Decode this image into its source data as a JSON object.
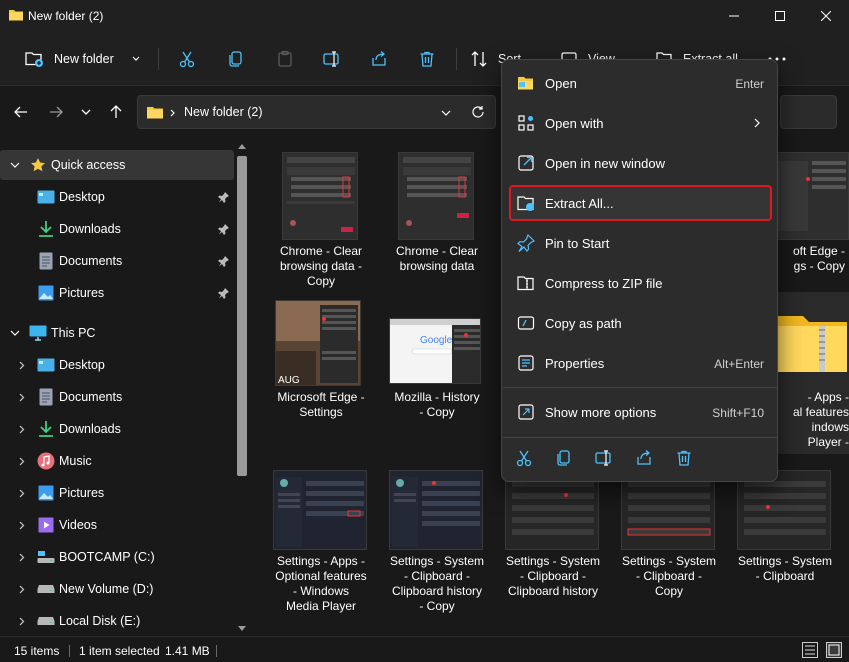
{
  "window": {
    "title": "New folder (2)"
  },
  "toolbar": {
    "new_folder_label": "New folder",
    "sort_label": "Sort",
    "view_label": "View",
    "extract_all_label": "Extract all"
  },
  "address": {
    "breadcrumb": "New folder (2)"
  },
  "nav": {
    "quick_access_label": "Quick access",
    "quick_items": [
      "Desktop",
      "Downloads",
      "Documents",
      "Pictures"
    ],
    "this_pc_label": "This PC",
    "pc_items": [
      "Desktop",
      "Documents",
      "Downloads",
      "Music",
      "Pictures",
      "Videos",
      "BOOTCAMP (C:)",
      "New Volume (D:)",
      "Local Disk (E:)"
    ]
  },
  "files": [
    {
      "caption": [
        "Chrome - Clear",
        "browsing data -",
        "Copy"
      ]
    },
    {
      "caption": [
        "Chrome - Clear",
        "browsing data"
      ]
    },
    {
      "caption": [
        "oft Edge -",
        "gs - Copy"
      ]
    },
    {
      "caption": [
        "Microsoft Edge -",
        "Settings"
      ]
    },
    {
      "caption": [
        "Mozilla - History",
        "- Copy"
      ]
    },
    {
      "caption": [
        "- Apps -",
        "al features",
        "indows",
        "Player -"
      ]
    },
    {
      "caption": [
        "Settings - Apps -",
        "Optional features",
        "- Windows",
        "Media Player"
      ]
    },
    {
      "caption": [
        "Settings - System",
        "- Clipboard -",
        "Clipboard history",
        "- Copy"
      ]
    },
    {
      "caption": [
        "Settings - System",
        "- Clipboard -",
        "Clipboard history"
      ]
    },
    {
      "caption": [
        "Settings - System",
        "- Clipboard -",
        "Copy"
      ]
    },
    {
      "caption": [
        "Settings - System",
        "- Clipboard"
      ]
    }
  ],
  "thumbs": {
    "google_logo_text": "Google",
    "aug_text": "AUG"
  },
  "status": {
    "item_count": "15 items",
    "selection": "1 item selected",
    "size": "1.41 MB"
  },
  "context_menu": {
    "items": [
      {
        "label": "Open",
        "shortcut": "Enter"
      },
      {
        "label": "Open with",
        "shortcut": ""
      },
      {
        "label": "Open in new window",
        "shortcut": ""
      },
      {
        "label": "Extract All...",
        "shortcut": ""
      },
      {
        "label": "Pin to Start",
        "shortcut": ""
      },
      {
        "label": "Compress to ZIP file",
        "shortcut": ""
      },
      {
        "label": "Copy as path",
        "shortcut": ""
      },
      {
        "label": "Properties",
        "shortcut": "Alt+Enter"
      },
      {
        "label": "Show more options",
        "shortcut": "Shift+F10"
      }
    ]
  },
  "colors": {
    "accent": "#4cc2ff",
    "folder": "#f8c840",
    "highlight_border": "#e0181f"
  }
}
